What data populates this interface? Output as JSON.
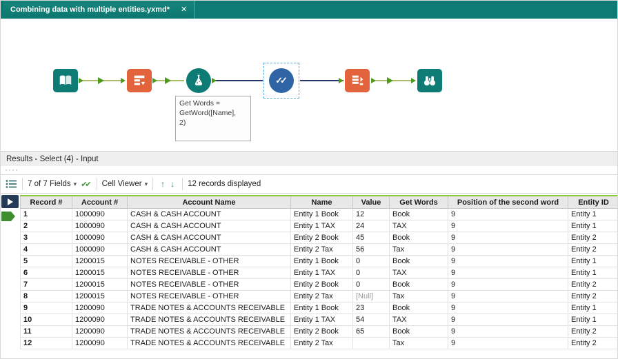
{
  "colors": {
    "teal": "#0E7C74",
    "orange": "#E2633C",
    "blue": "#2F64A5",
    "navy": "#27346B",
    "olive": "#8FA43A",
    "green": "#4E9A1C",
    "accent-green": "#8DC63F"
  },
  "tab": {
    "title": "Combining data with multiple entities.yxmd*",
    "close_glyph": "✕"
  },
  "canvas": {
    "annotation": "Get Words =\nGetWord([Name],\n2)",
    "tools": [
      "input-data",
      "text-to-columns",
      "formula",
      "select",
      "arrange",
      "browse"
    ],
    "select_checks": "✓✓"
  },
  "results": {
    "panel_title": "Results - Select (4) - Input",
    "toolbar": {
      "fields_label": "7 of 7 Fields",
      "caret": "▾",
      "dblcheck": "✔✔",
      "cell_viewer_label": "Cell Viewer",
      "up_arrow": "↑",
      "down_arrow": "↓",
      "records_label": "12 records displayed",
      "grip": "····"
    },
    "table": {
      "columns": [
        "Record #",
        "Account #",
        "Account Name",
        "Name",
        "Value",
        "Get Words",
        "Position of the second word",
        "Entity ID"
      ],
      "rows": [
        [
          "1",
          "1000090",
          "CASH & CASH ACCOUNT",
          "Entity 1 Book",
          "12",
          "Book",
          "9",
          "Entity 1"
        ],
        [
          "2",
          "1000090",
          "CASH & CASH ACCOUNT",
          "Entity 1 TAX",
          "24",
          "TAX",
          "9",
          "Entity 1"
        ],
        [
          "3",
          "1000090",
          "CASH & CASH ACCOUNT",
          "Entity 2 Book",
          "45",
          "Book",
          "9",
          "Entity 2"
        ],
        [
          "4",
          "1000090",
          "CASH & CASH ACCOUNT",
          "Entity 2 Tax",
          "56",
          "Tax",
          "9",
          "Entity 2"
        ],
        [
          "5",
          "1200015",
          "NOTES RECEIVABLE - OTHER",
          "Entity 1 Book",
          "0",
          "Book",
          "9",
          "Entity 1"
        ],
        [
          "6",
          "1200015",
          "NOTES RECEIVABLE - OTHER",
          "Entity 1 TAX",
          "0",
          "TAX",
          "9",
          "Entity 1"
        ],
        [
          "7",
          "1200015",
          "NOTES RECEIVABLE - OTHER",
          "Entity 2 Book",
          "0",
          "Book",
          "9",
          "Entity 2"
        ],
        [
          "8",
          "1200015",
          "NOTES RECEIVABLE - OTHER",
          "Entity 2 Tax",
          "[Null]",
          "Tax",
          "9",
          "Entity 2"
        ],
        [
          "9",
          "1200090",
          "TRADE NOTES & ACCOUNTS RECEIVABLE",
          "Entity 1 Book",
          "23",
          "Book",
          "9",
          "Entity 1"
        ],
        [
          "10",
          "1200090",
          "TRADE NOTES & ACCOUNTS RECEIVABLE",
          "Entity 1 TAX",
          "54",
          "TAX",
          "9",
          "Entity 1"
        ],
        [
          "11",
          "1200090",
          "TRADE NOTES & ACCOUNTS RECEIVABLE",
          "Entity 2 Book",
          "65",
          "Book",
          "9",
          "Entity 2"
        ],
        [
          "12",
          "1200090",
          "TRADE NOTES & ACCOUNTS RECEIVABLE",
          "Entity 2 Tax",
          "",
          "Tax",
          "9",
          "Entity 2"
        ]
      ]
    }
  }
}
